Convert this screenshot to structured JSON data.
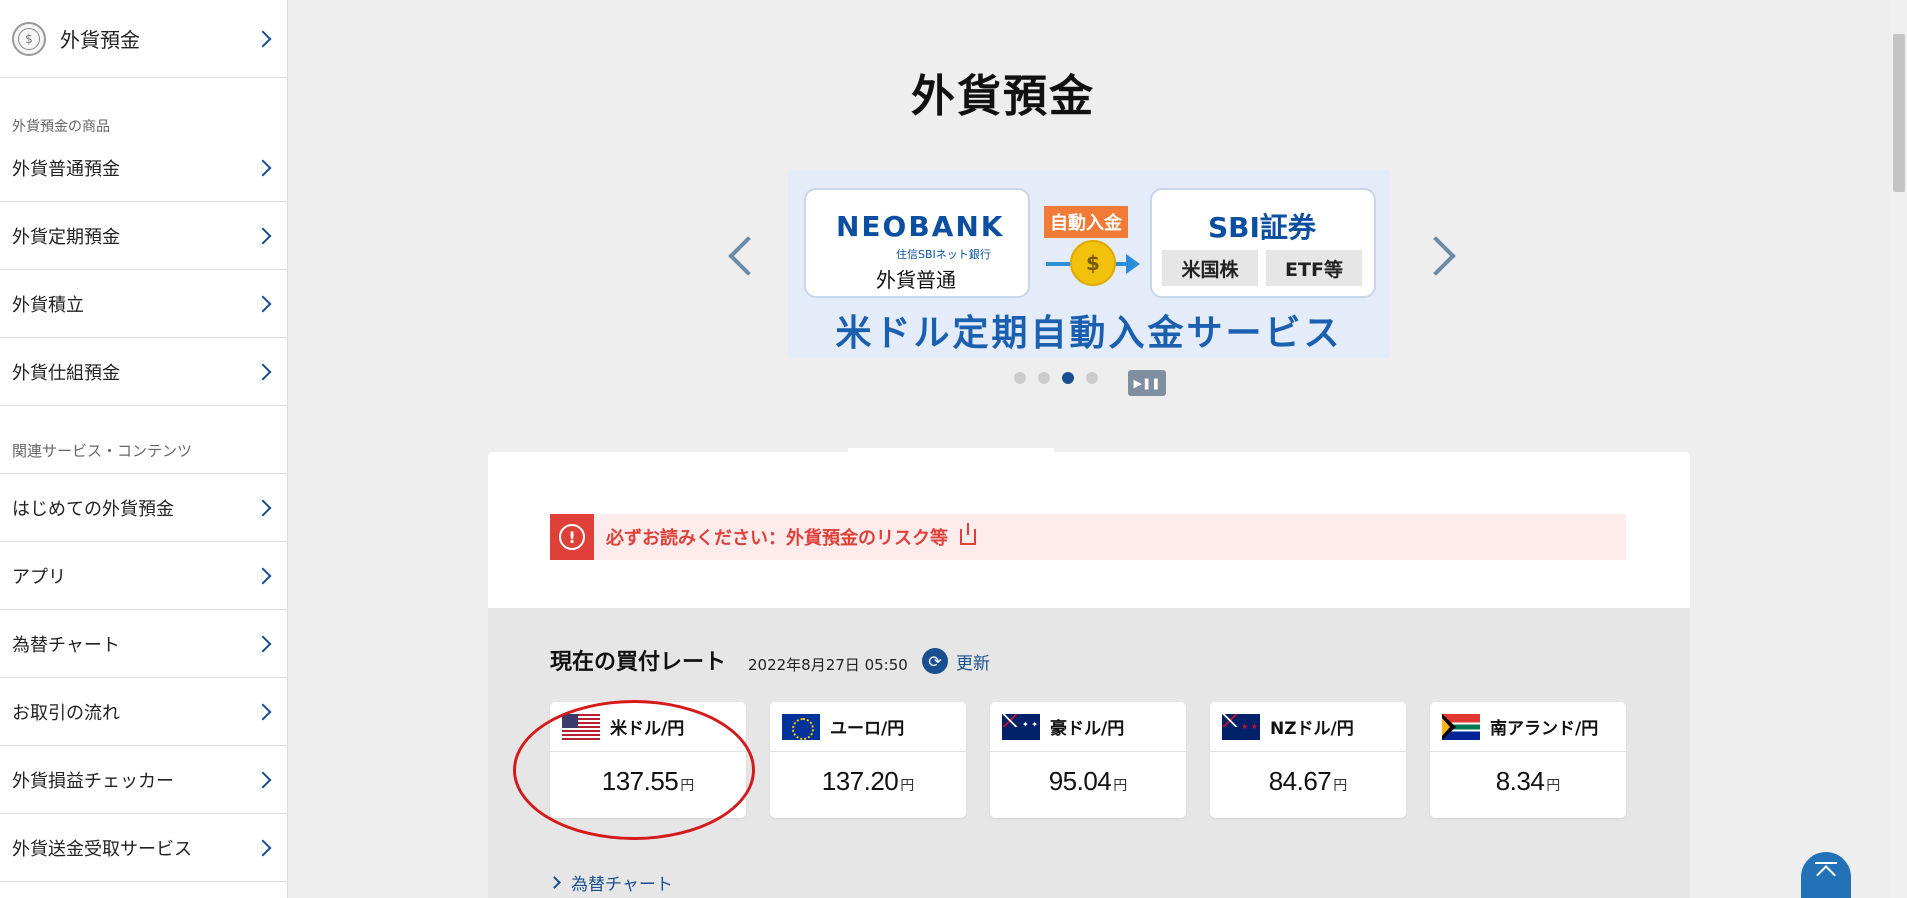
{
  "sidebar": {
    "top": {
      "label": "外貨預金",
      "icon": "dollar-coin-icon"
    },
    "section1": "外貨預金の商品",
    "products": [
      {
        "label": "外貨普通預金"
      },
      {
        "label": "外貨定期預金"
      },
      {
        "label": "外貨積立"
      },
      {
        "label": "外貨仕組預金"
      }
    ],
    "section2": "関連サービス・コンテンツ",
    "services": [
      {
        "label": "はじめての外貨預金"
      },
      {
        "label": "アプリ"
      },
      {
        "label": "為替チャート"
      },
      {
        "label": "お取引の流れ"
      },
      {
        "label": "外貨損益チェッカー"
      },
      {
        "label": "外貨送金受取サービス"
      }
    ]
  },
  "main": {
    "title": "外貨預金",
    "banner": {
      "neo_logo": "NEOBANK",
      "neo_sub": "住信SBIネット銀行",
      "neo_account": "外貨普通",
      "auto_tag": "自動入金",
      "coin": "$",
      "sbi_logo": "SBI証券",
      "chip1": "米国株",
      "chip2": "ETF等",
      "title": "米ドル定期自動入金サービス"
    },
    "carousel": {
      "dots": 4,
      "active_index": 2,
      "pause_label": "▶❚❚"
    },
    "alert": {
      "text": "必ずお読みください：外貨預金のリスク等"
    },
    "rates": {
      "title": "現在の買付レート",
      "timestamp": "2022年8月27日 05:50",
      "refresh_label": "更新",
      "items": [
        {
          "pair": "米ドル/円",
          "value": "137.55",
          "unit": "円",
          "flag": "us"
        },
        {
          "pair": "ユーロ/円",
          "value": "137.20",
          "unit": "円",
          "flag": "eu"
        },
        {
          "pair": "豪ドル/円",
          "value": "95.04",
          "unit": "円",
          "flag": "au"
        },
        {
          "pair": "NZドル/円",
          "value": "84.67",
          "unit": "円",
          "flag": "nz"
        },
        {
          "pair": "南アランド/円",
          "value": "8.34",
          "unit": "円",
          "flag": "za"
        }
      ],
      "chart_link": "為替チャート"
    }
  },
  "colors": {
    "brand_blue": "#1a4f8f",
    "alert_red": "#e0403a",
    "highlight": "#d41a1a"
  }
}
